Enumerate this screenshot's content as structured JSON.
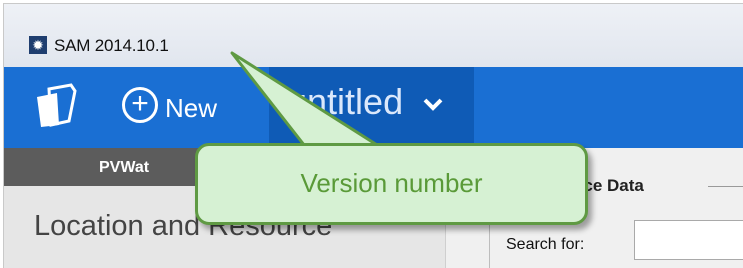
{
  "window": {
    "title": "SAM 2014.10.1",
    "app_icon": "sun-icon"
  },
  "toolbar": {
    "file_menu_icon": "document-stack-icon",
    "new_icon": "plus-circle-icon",
    "new_label": "New",
    "case_tab_label": "untitled",
    "case_tab_menu_icon": "chevron-down-icon"
  },
  "left_panel": {
    "header": "PVWat",
    "item": "Location and Resource"
  },
  "right_panel": {
    "group_title": "ource Data",
    "search_label": "Search for:",
    "search_value": ""
  },
  "callout": {
    "text": "Version number",
    "fill": "#d6f1d3",
    "border": "#5f9a43",
    "text_color": "#5a9a38"
  },
  "colors": {
    "toolbar": "#1a6fd3",
    "active_tab": "#0f5bb6",
    "panel_header": "#5c5c5c"
  }
}
